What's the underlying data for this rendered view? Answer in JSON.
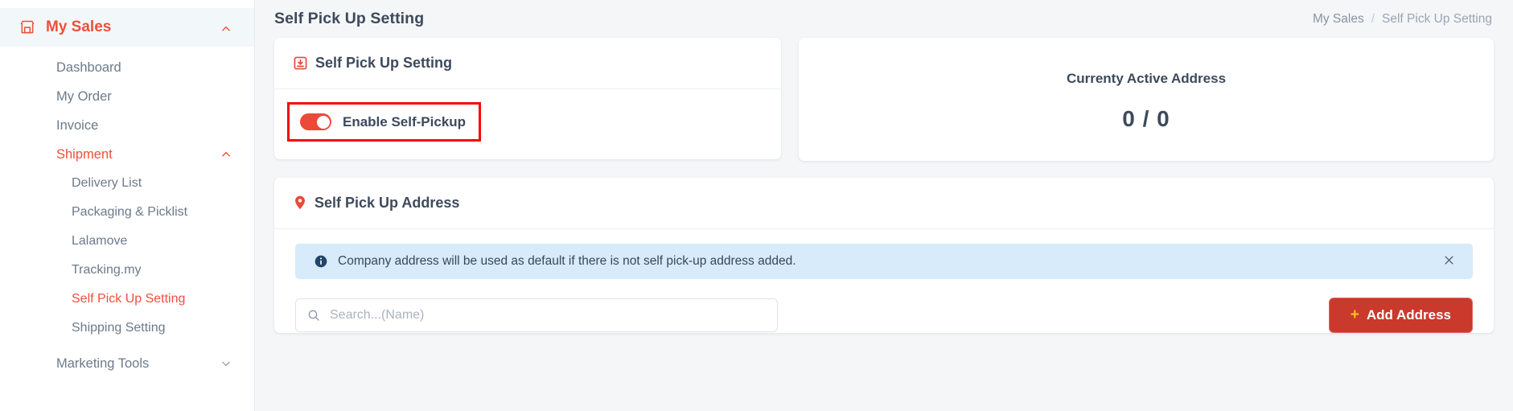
{
  "sidebar": {
    "group": {
      "label": "My Sales",
      "icon": "store-icon",
      "expanded_icon": "chevron-up-icon"
    },
    "items": [
      {
        "label": "Dashboard",
        "level": 1,
        "active": false,
        "icon": null
      },
      {
        "label": "My Order",
        "level": 1,
        "active": false,
        "icon": null
      },
      {
        "label": "Invoice",
        "level": 1,
        "active": false,
        "icon": null
      },
      {
        "label": "Shipment",
        "level": 1,
        "active": true,
        "icon": "chevron-up-icon"
      },
      {
        "label": "Delivery List",
        "level": 2,
        "active": false,
        "icon": null
      },
      {
        "label": "Packaging & Picklist",
        "level": 2,
        "active": false,
        "icon": null
      },
      {
        "label": "Lalamove",
        "level": 2,
        "active": false,
        "icon": null
      },
      {
        "label": "Tracking.my",
        "level": 2,
        "active": false,
        "icon": null
      },
      {
        "label": "Self Pick Up Setting",
        "level": 2,
        "active": true,
        "icon": null
      },
      {
        "label": "Shipping Setting",
        "level": 2,
        "active": false,
        "icon": null
      },
      {
        "label": "Marketing Tools",
        "level": 1,
        "active": false,
        "icon": "chevron-down-icon"
      }
    ]
  },
  "header": {
    "title": "Self Pick Up Setting",
    "breadcrumb": {
      "parent": "My Sales",
      "separator": "/",
      "current": "Self Pick Up Setting"
    }
  },
  "setting_card": {
    "title": "Self Pick Up Setting",
    "icon": "inbox-download-icon",
    "toggle": {
      "label": "Enable Self-Pickup",
      "state": "on"
    }
  },
  "stat_card": {
    "title": "Currenty Active Address",
    "value": "0 / 0"
  },
  "address_card": {
    "title": "Self Pick Up Address",
    "icon": "map-pin-icon",
    "alert": {
      "icon": "info-circle-icon",
      "text": "Company address will be used as default if there is not self pick-up address added.",
      "close_icon": "close-icon"
    },
    "search": {
      "icon": "search-icon",
      "placeholder": "Search...(Name)",
      "value": ""
    },
    "add_button": {
      "plus": "+",
      "label": "Add Address"
    }
  },
  "colors": {
    "brand_red": "#ef4e3b",
    "button_red": "#c9392c",
    "highlight_red": "#fb0505",
    "alert_blue": "#d8ebfa",
    "text_dark": "#3d4a5c",
    "text_muted": "#6c7a89",
    "plus_yellow": "#f5c518"
  }
}
